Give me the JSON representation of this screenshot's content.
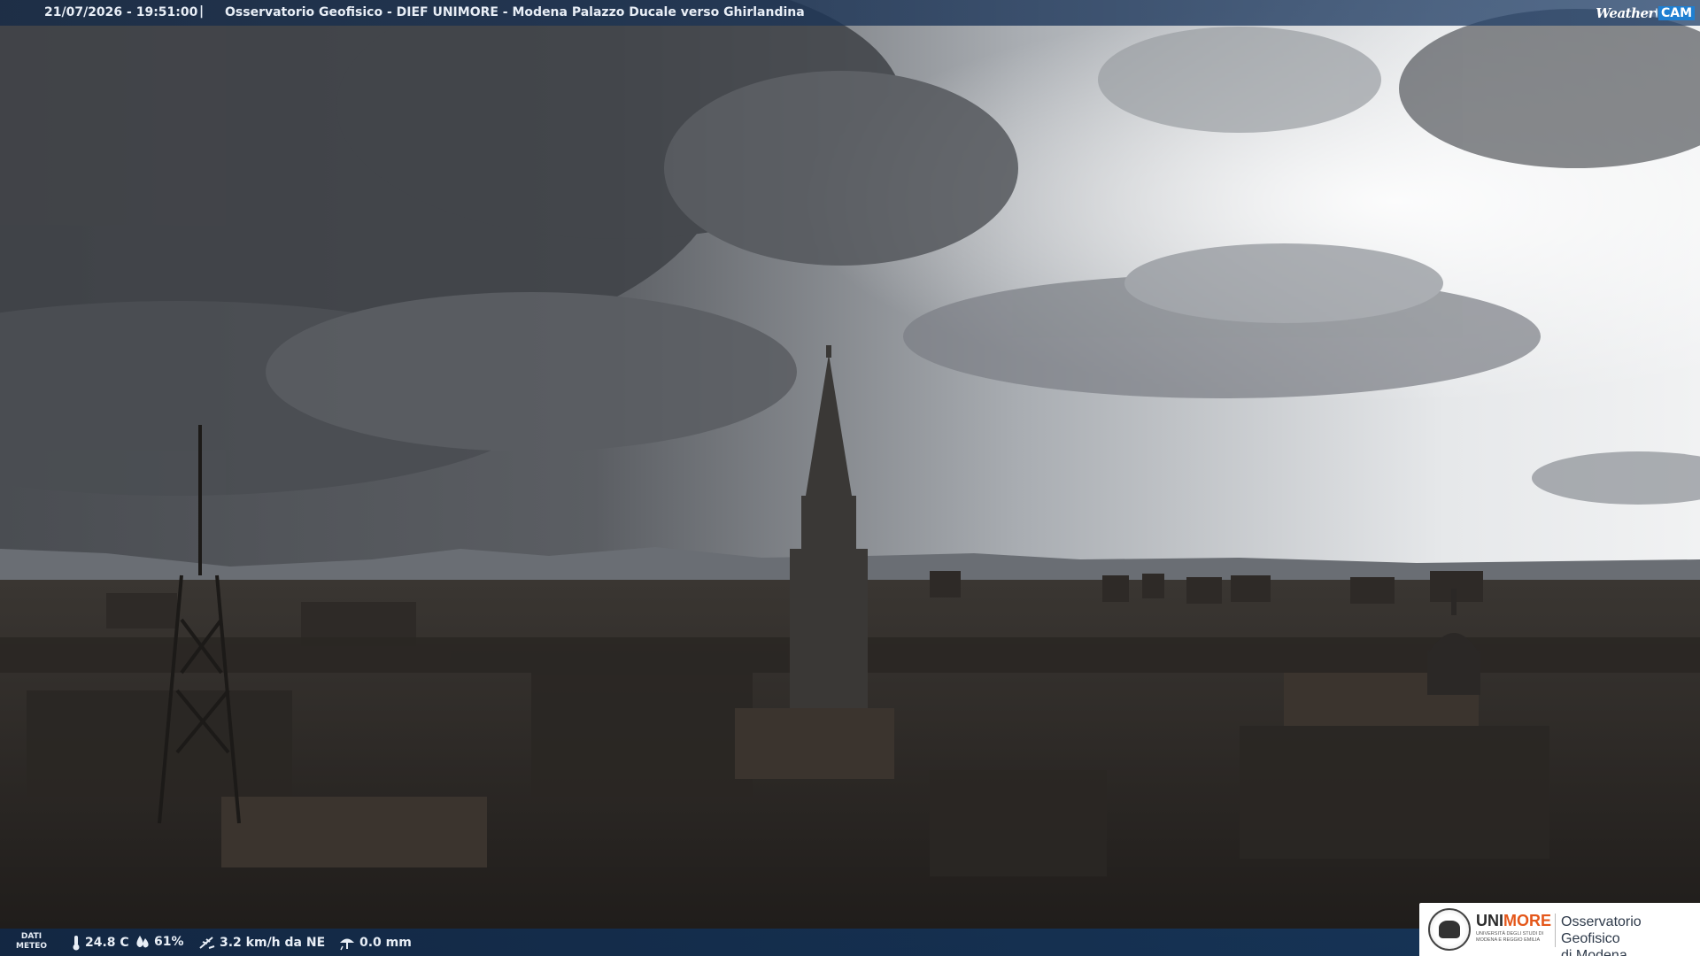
{
  "header": {
    "timestamp": "21/07/2026 - 19:51:00",
    "separator": "|",
    "title": "Osservatorio Geofisico - DIEF UNIMORE - Modena Palazzo Ducale verso Ghirlandina",
    "brand_weather": "Weather",
    "brand_cam": "CAM"
  },
  "footer": {
    "dati_line1": "DATI",
    "dati_line2": "METEO",
    "temperature": "24.8 C",
    "humidity": "61%",
    "wind": "3.2 km/h da NE",
    "rain": "0.0 mm",
    "icons": [
      "thermometer-icon",
      "humidity-drop-icon",
      "wind-icon",
      "rain-icon"
    ]
  },
  "logo": {
    "uni_part1": "UNI",
    "uni_part2": "MORE",
    "uni_sub1": "UNIVERSITÀ DEGLI STUDI DI",
    "uni_sub2": "MODENA E REGGIO EMILIA",
    "observatory_line1": "Osservatorio Geofisico",
    "observatory_line2": "di Modena"
  },
  "colors": {
    "bar_blue": "#1c3a60",
    "brand_accent": "#1f7fd1",
    "unimore_orange": "#e4571a"
  }
}
